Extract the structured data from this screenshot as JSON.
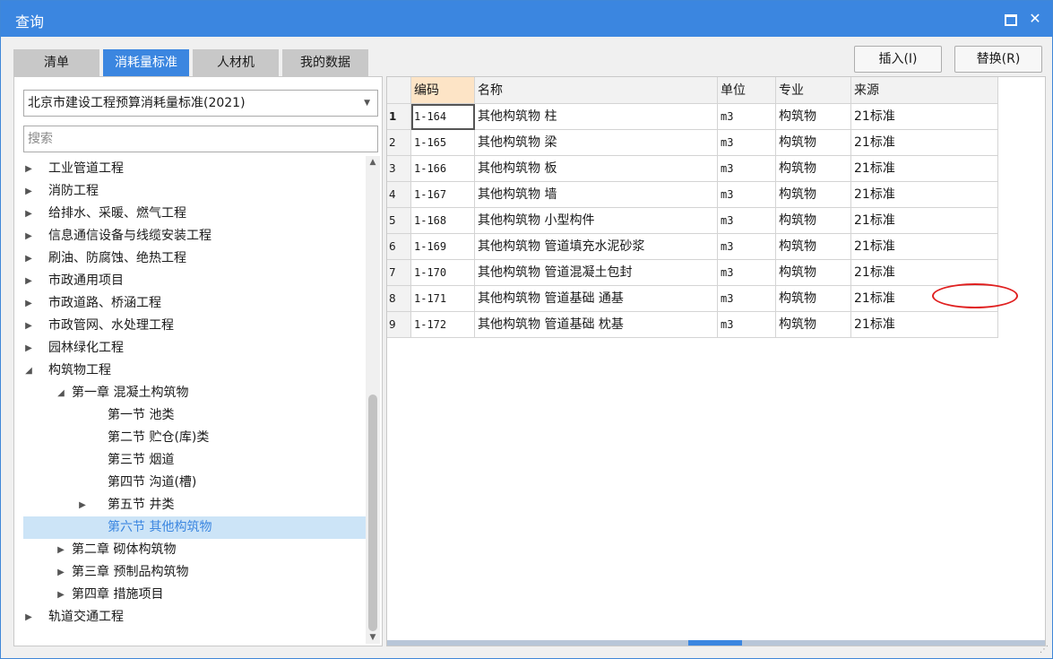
{
  "window": {
    "title": "查询",
    "maximize_label": "",
    "close_label": "✕"
  },
  "tabs": [
    {
      "label": "清单",
      "active": false
    },
    {
      "label": "消耗量标准",
      "active": true
    },
    {
      "label": "人材机",
      "active": false
    },
    {
      "label": "我的数据",
      "active": false
    }
  ],
  "actions": {
    "insert_label": "插入(I)",
    "replace_label": "替换(R)"
  },
  "left_panel": {
    "standard_selected": "北京市建设工程预算消耗量标准(2021)",
    "search_placeholder": "搜索",
    "tree": [
      {
        "label": "工业管道工程",
        "level": 0,
        "state": "collapsed"
      },
      {
        "label": "消防工程",
        "level": 0,
        "state": "collapsed"
      },
      {
        "label": "给排水、采暖、燃气工程",
        "level": 0,
        "state": "collapsed"
      },
      {
        "label": "信息通信设备与线缆安装工程",
        "level": 0,
        "state": "collapsed"
      },
      {
        "label": "刷油、防腐蚀、绝热工程",
        "level": 0,
        "state": "collapsed"
      },
      {
        "label": "市政通用项目",
        "level": 0,
        "state": "collapsed"
      },
      {
        "label": "市政道路、桥涵工程",
        "level": 0,
        "state": "collapsed"
      },
      {
        "label": "市政管网、水处理工程",
        "level": 0,
        "state": "collapsed"
      },
      {
        "label": "园林绿化工程",
        "level": 0,
        "state": "collapsed"
      },
      {
        "label": "构筑物工程",
        "level": 0,
        "state": "expanded"
      },
      {
        "label": "第一章 混凝土构筑物",
        "level": 1,
        "state": "expanded"
      },
      {
        "label": "第一节 池类",
        "level": 2,
        "state": "leaf"
      },
      {
        "label": "第二节 贮仓(库)类",
        "level": 2,
        "state": "leaf"
      },
      {
        "label": "第三节 烟道",
        "level": 2,
        "state": "leaf"
      },
      {
        "label": "第四节 沟道(槽)",
        "level": 2,
        "state": "leaf"
      },
      {
        "label": "第五节 井类",
        "level": 2,
        "state": "collapsed"
      },
      {
        "label": "第六节 其他构筑物",
        "level": 2,
        "state": "leaf",
        "selected": true
      },
      {
        "label": "第二章 砌体构筑物",
        "level": 1,
        "state": "collapsed"
      },
      {
        "label": "第三章 预制品构筑物",
        "level": 1,
        "state": "collapsed"
      },
      {
        "label": "第四章 措施项目",
        "level": 1,
        "state": "collapsed"
      },
      {
        "label": "轨道交通工程",
        "level": 0,
        "state": "collapsed"
      }
    ]
  },
  "grid": {
    "columns": [
      "",
      "编码",
      "名称",
      "单位",
      "专业",
      "来源"
    ],
    "rows": [
      {
        "num": "1",
        "code": "1-164",
        "name": "其他构筑物 柱",
        "unit": "m3",
        "major": "构筑物",
        "source": "21标准"
      },
      {
        "num": "2",
        "code": "1-165",
        "name": "其他构筑物 梁",
        "unit": "m3",
        "major": "构筑物",
        "source": "21标准"
      },
      {
        "num": "3",
        "code": "1-166",
        "name": "其他构筑物 板",
        "unit": "m3",
        "major": "构筑物",
        "source": "21标准"
      },
      {
        "num": "4",
        "code": "1-167",
        "name": "其他构筑物 墙",
        "unit": "m3",
        "major": "构筑物",
        "source": "21标准"
      },
      {
        "num": "5",
        "code": "1-168",
        "name": "其他构筑物 小型构件",
        "unit": "m3",
        "major": "构筑物",
        "source": "21标准"
      },
      {
        "num": "6",
        "code": "1-169",
        "name": "其他构筑物 管道填充水泥砂浆",
        "unit": "m3",
        "major": "构筑物",
        "source": "21标准"
      },
      {
        "num": "7",
        "code": "1-170",
        "name": "其他构筑物 管道混凝土包封",
        "unit": "m3",
        "major": "构筑物",
        "source": "21标准"
      },
      {
        "num": "8",
        "code": "1-171",
        "name": "其他构筑物 管道基础 通基",
        "unit": "m3",
        "major": "构筑物",
        "source": "21标准"
      },
      {
        "num": "9",
        "code": "1-172",
        "name": "其他构筑物 管道基础 枕基",
        "unit": "m3",
        "major": "构筑物",
        "source": "21标准"
      }
    ]
  },
  "colors": {
    "accent": "#3b86e0",
    "sorted_header": "#fde4c6",
    "selected_tree": "#cce4f7",
    "annotation": "#e02020"
  }
}
